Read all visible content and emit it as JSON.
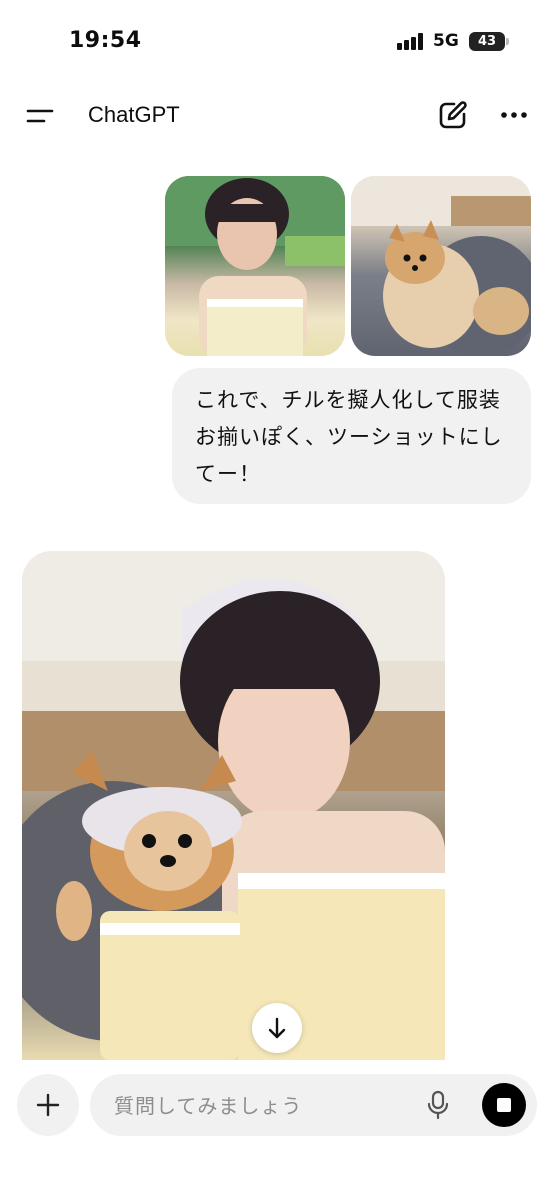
{
  "status_bar": {
    "time": "19:54",
    "network": "5G",
    "battery": "43"
  },
  "header": {
    "title": "ChatGPT",
    "menu_icon": "menu-icon",
    "edit_icon": "new-chat-icon",
    "more_icon": "more-icon"
  },
  "messages": {
    "user_images": [
      "photo-woman",
      "photo-pomeranian"
    ],
    "user_text": "これで、チルを擬人化して服装お揃いぽく、ツーショットにしてー！",
    "assistant_image": "generated-image"
  },
  "composer": {
    "placeholder": "質問してみましょう",
    "value": "",
    "attach_icon": "plus-icon",
    "mic_icon": "microphone-icon",
    "stop_icon": "stop-icon"
  },
  "colors": {
    "bubble": "#f1f1f1",
    "text": "#0d0d0d",
    "stop_button": "#000000"
  }
}
